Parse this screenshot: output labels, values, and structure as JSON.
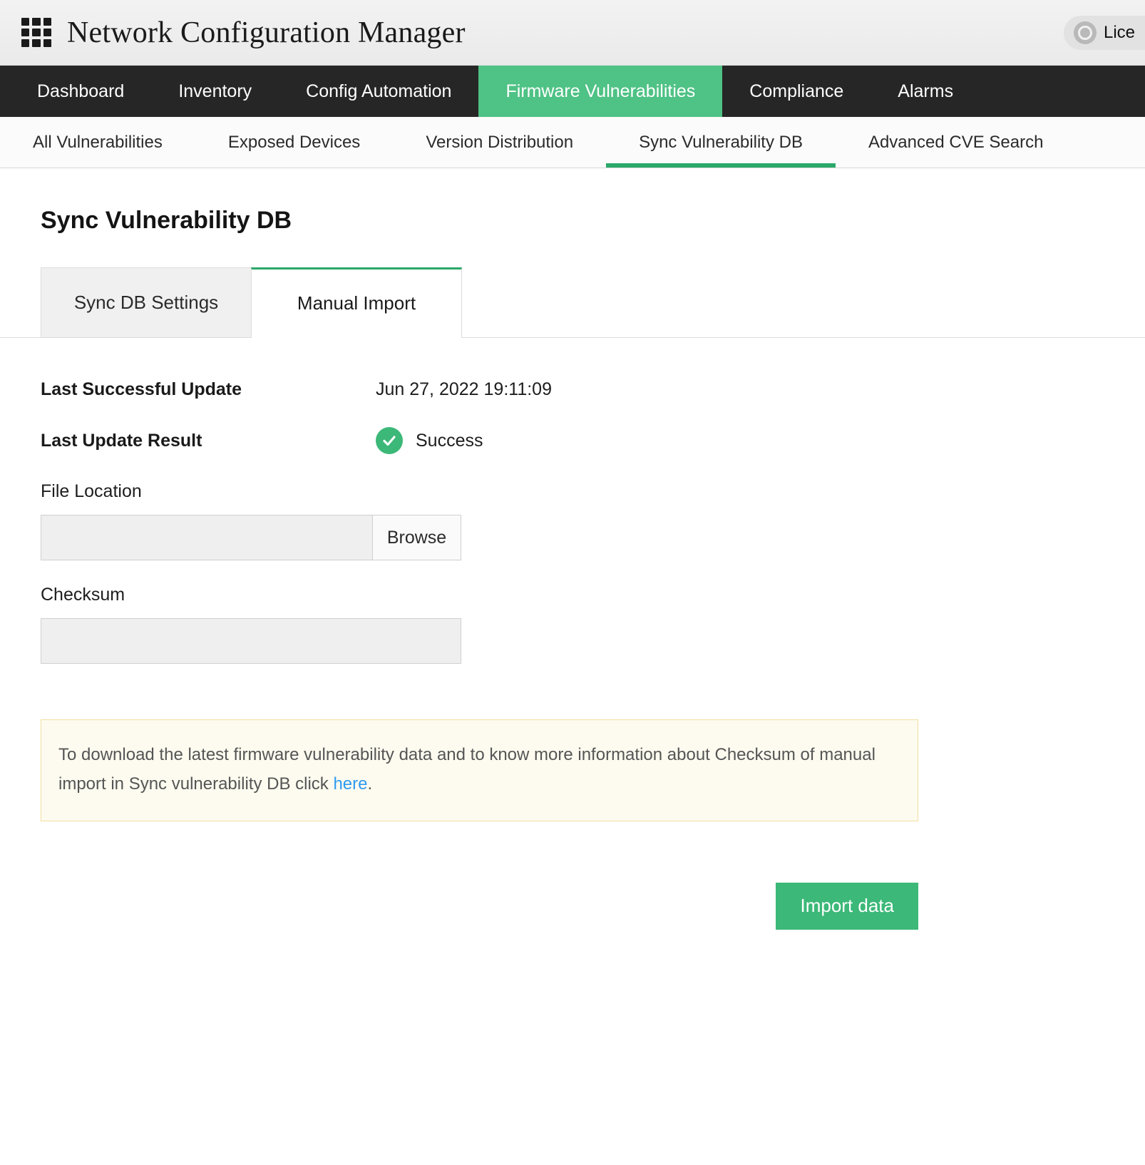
{
  "header": {
    "app_title": "Network Configuration Manager",
    "grid_icon": "apps-grid-icon",
    "license": {
      "label": "Lice",
      "icon": "license-badge-icon"
    }
  },
  "main_nav": {
    "items": [
      {
        "label": "Dashboard",
        "active": false
      },
      {
        "label": "Inventory",
        "active": false
      },
      {
        "label": "Config Automation",
        "active": false
      },
      {
        "label": "Firmware Vulnerabilities",
        "active": true
      },
      {
        "label": "Compliance",
        "active": false
      },
      {
        "label": "Alarms",
        "active": false
      }
    ],
    "active_color": "#4fc285",
    "background": "#262626"
  },
  "sub_nav": {
    "items": [
      {
        "label": "All Vulnerabilities",
        "active": false
      },
      {
        "label": "Exposed Devices",
        "active": false
      },
      {
        "label": "Version Distribution",
        "active": false
      },
      {
        "label": "Sync Vulnerability DB",
        "active": true
      },
      {
        "label": "Advanced CVE Search",
        "active": false
      }
    ],
    "underline_color": "#2aa86a"
  },
  "page": {
    "title": "Sync Vulnerability DB",
    "tabs": [
      {
        "label": "Sync DB Settings",
        "active": false
      },
      {
        "label": "Manual Import",
        "active": true
      }
    ]
  },
  "form": {
    "last_successful_update": {
      "label": "Last Successful Update",
      "value": "Jun 27, 2022 19:11:09"
    },
    "last_update_result": {
      "label": "Last Update Result",
      "value": "Success",
      "status_icon": "check-circle-icon",
      "status_color": "#3cb878"
    },
    "file_location": {
      "label": "File Location",
      "value": "",
      "placeholder": "",
      "browse_label": "Browse"
    },
    "checksum": {
      "label": "Checksum",
      "value": "",
      "placeholder": ""
    }
  },
  "note": {
    "text_before_link": "To download the latest firmware vulnerability data and to know more information about Checksum of manual import in Sync vulnerability DB click ",
    "link_text": "here",
    "text_after_link": ".",
    "border_color": "#f0dfa0",
    "background_color": "#fdfbef",
    "link_color": "#2f9bf0"
  },
  "actions": {
    "import_label": "Import data",
    "import_color": "#3cb878"
  }
}
